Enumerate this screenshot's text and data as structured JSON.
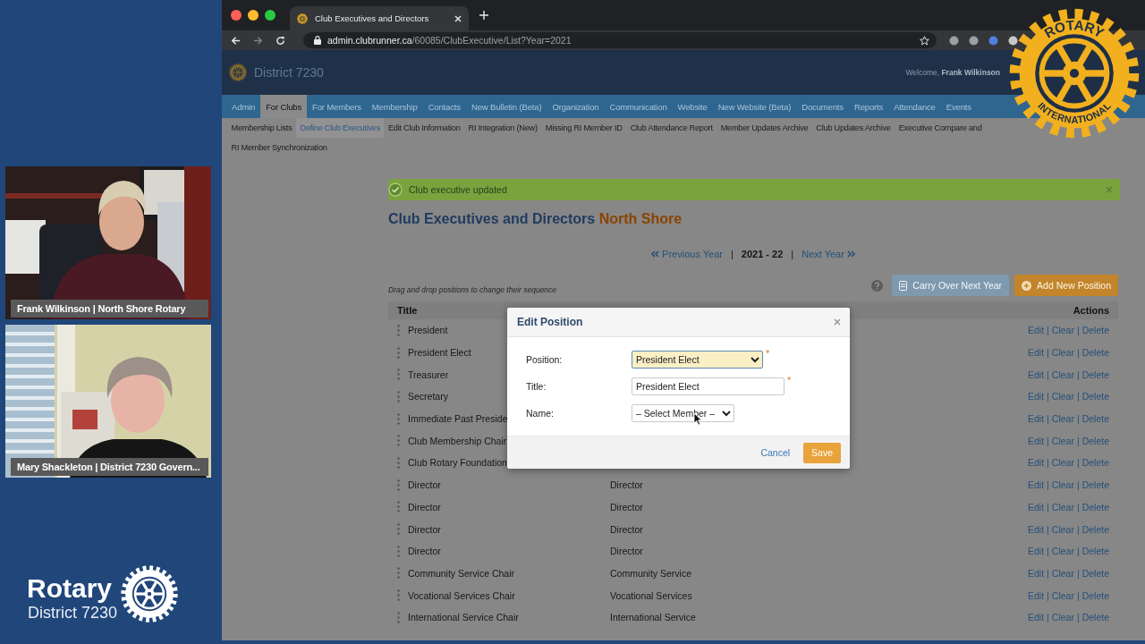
{
  "call": {
    "tiles": [
      {
        "kind": "picture",
        "caption": "Frank Wilkinson | North Shore Rotary"
      },
      {
        "kind": "picture",
        "caption": "Mary Shackleton | District 7230 Govern..."
      }
    ],
    "brand": {
      "name": "Rotary",
      "district": "District 7230"
    },
    "overlay_logo": {
      "top_text": "ROTARY",
      "bottom_text": "INTERNATIONAL"
    }
  },
  "browser": {
    "tab": {
      "title": "Club Executives and Directors"
    },
    "url": {
      "host": "admin.clubrunner.ca",
      "path": "/60085/ClubExecutive/List?Year=2021"
    }
  },
  "site": {
    "title": "District 7230",
    "welcome": "Welcome, **Frank Wilkinson**",
    "nav": [
      {
        "label": "Admin",
        "selected": false
      },
      {
        "label": "For Clubs",
        "selected": true
      },
      {
        "label": "For Members",
        "selected": false
      },
      {
        "label": "Membership",
        "selected": false
      },
      {
        "label": "Contacts",
        "selected": false
      },
      {
        "label": "New Bulletin (Beta)",
        "selected": false
      },
      {
        "label": "Organization",
        "selected": false
      },
      {
        "label": "Communication",
        "selected": false
      },
      {
        "label": "Website",
        "selected": false
      },
      {
        "label": "New Website (Beta)",
        "selected": false
      },
      {
        "label": "Documents",
        "selected": false
      },
      {
        "label": "Reports",
        "selected": false
      },
      {
        "label": "Attendance",
        "selected": false
      },
      {
        "label": "Events",
        "selected": false
      }
    ],
    "subnav": [
      [
        {
          "label": "Membership Lists",
          "selected": false
        },
        {
          "label": "Define Club Executives",
          "selected": true
        },
        {
          "label": "Edit Club Information",
          "selected": false
        },
        {
          "label": "RI Integration (New)",
          "selected": false
        },
        {
          "label": "Missing RI Member ID",
          "selected": false
        },
        {
          "label": "Club Attendance Report",
          "selected": false
        },
        {
          "label": "Member Updates Archive",
          "selected": false
        },
        {
          "label": "Club Updates Archive",
          "selected": false
        },
        {
          "label": "Executive Compare and",
          "selected": false
        }
      ],
      [
        {
          "label": "RI Member Synchronization",
          "selected": false
        }
      ]
    ]
  },
  "page": {
    "alert": "Club executive updated",
    "heading": "Club Executives and Directors",
    "club": "North Shore",
    "year_nav": {
      "previous": "Previous Year",
      "year": "2021 - 22",
      "next": "Next Year"
    },
    "year_separators": [
      "|",
      "|"
    ],
    "hint": "Drag and drop positions to change their sequence",
    "buttons": [
      {
        "label": "Carry Over Next Year",
        "kind": "carry",
        "disabled": true
      },
      {
        "label": "Add New Position",
        "kind": "add",
        "disabled": false
      }
    ],
    "columns": {
      "title": "Title",
      "actions": "Actions"
    },
    "rows": [
      {
        "title": "President",
        "actions": [
          "Edit",
          "|",
          "Clear",
          "|",
          "Delete"
        ]
      },
      {
        "title": "President Elect",
        "actions": [
          "Edit",
          "|",
          "Clear",
          "|",
          "Delete"
        ]
      },
      {
        "title": "Treasurer",
        "actions": [
          "Edit",
          "|",
          "Clear",
          "|",
          "Delete"
        ]
      },
      {
        "title": "Secretary",
        "actions": [
          "Edit",
          "|",
          "Clear",
          "|",
          "Delete"
        ]
      },
      {
        "title": "Immediate Past Preside",
        "actions": [
          "Edit",
          "|",
          "Clear",
          "|",
          "Delete"
        ]
      },
      {
        "title": "Club Membership Chair",
        "actions": [
          "Edit",
          "|",
          "Clear",
          "|",
          "Delete"
        ]
      },
      {
        "title": "Club Rotary Foundation",
        "actions": [
          "Edit",
          "|",
          "Clear",
          "|",
          "Delete"
        ]
      },
      {
        "title": "Director",
        "column_2": "Director",
        "actions": [
          "Edit",
          "|",
          "Clear",
          "|",
          "Delete"
        ]
      },
      {
        "title": "Director",
        "column_2": "Director",
        "actions": [
          "Edit",
          "|",
          "Clear",
          "|",
          "Delete"
        ]
      },
      {
        "title": "Director",
        "column_2": "Director",
        "actions": [
          "Edit",
          "|",
          "Clear",
          "|",
          "Delete"
        ]
      },
      {
        "title": "Director",
        "column_2": "Director",
        "actions": [
          "Edit",
          "|",
          "Clear",
          "|",
          "Delete"
        ]
      },
      {
        "title": "Community Service Chair",
        "column_2": "Community Service",
        "actions": [
          "Edit",
          "|",
          "Clear",
          "|",
          "Delete"
        ]
      },
      {
        "title": "Vocational Services Chair",
        "column_2": "Vocational Services",
        "actions": [
          "Edit",
          "|",
          "Clear",
          "|",
          "Delete"
        ]
      },
      {
        "title": "International Service Chair",
        "column_2": "International Service",
        "actions": [
          "Edit",
          "|",
          "Clear",
          "|",
          "Delete"
        ]
      }
    ]
  },
  "modal": {
    "title": "Edit Position",
    "required_mark": "*",
    "fields": [
      {
        "label": "Position:",
        "kind": "select",
        "value": "President Elect",
        "required": true,
        "highlighted": true
      },
      {
        "label": "Title:",
        "kind": "input",
        "value": "President Elect",
        "required": true,
        "highlighted": false
      },
      {
        "label": "Name:",
        "kind": "select",
        "value": "– Select Member –",
        "required": false,
        "highlighted": false
      }
    ],
    "cancel": "Cancel",
    "save": "Save"
  }
}
